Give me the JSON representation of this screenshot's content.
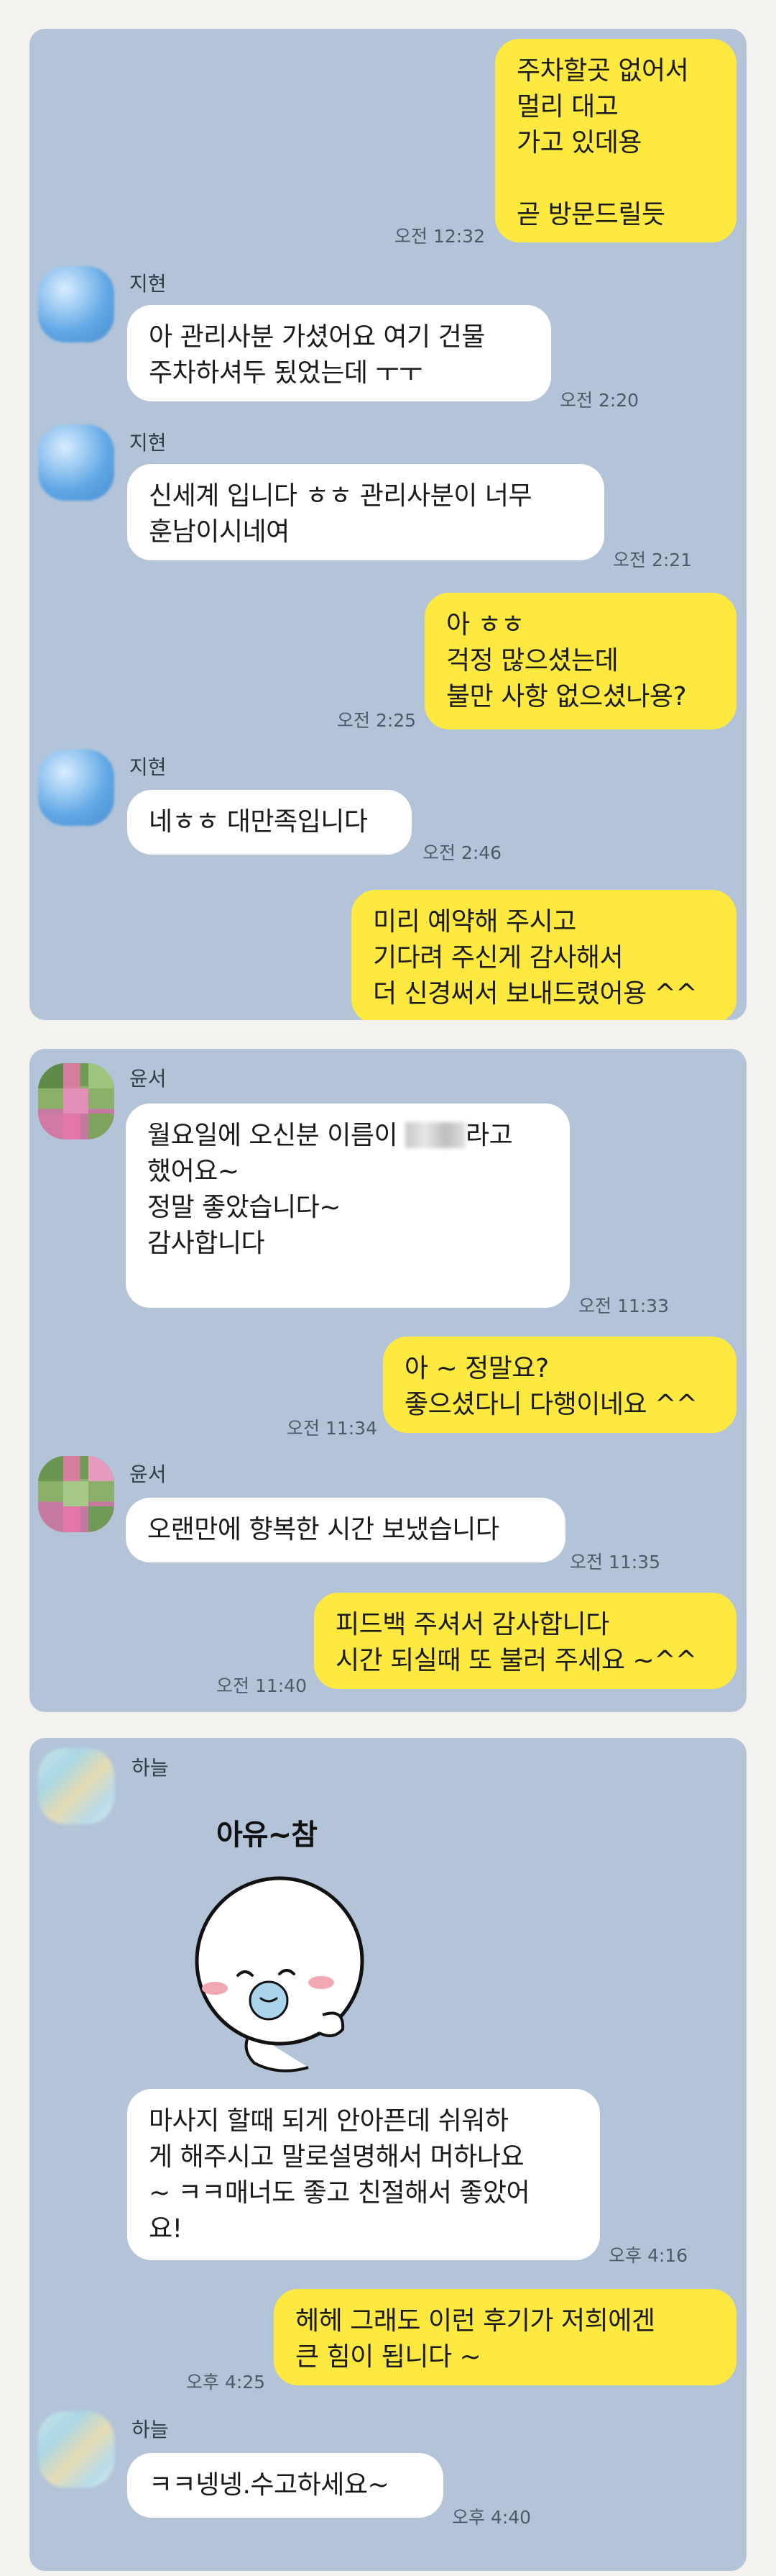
{
  "panel1": {
    "m1": {
      "text": "주차할곳 없어서\n멀리 대고\n가고 있데용\n\n곧 방문드릴듯",
      "time": "오전 12:32"
    },
    "m2": {
      "sender": "지현",
      "text": "아 관리사분 가셨어요 여기 건물\n주차하셔두 됬었는데 ㅜㅜ",
      "time": "오전 2:20"
    },
    "m3": {
      "sender": "지현",
      "text": "신세계 입니다 ㅎㅎ 관리사분이 너무\n훈남이시네여",
      "time": "오전 2:21"
    },
    "m4": {
      "text": "아 ㅎㅎ\n걱정 많으셨는데\n불만 사항 없으셨나용?",
      "time": "오전 2:25"
    },
    "m5": {
      "sender": "지현",
      "text": "네ㅎㅎ 대만족입니다",
      "time": "오전 2:46"
    },
    "m6": {
      "text": "미리 예약해 주시고\n기다려 주신게 감사해서\n더 신경써서 보내드렸어용 ^^"
    }
  },
  "panel2": {
    "m1": {
      "sender": "윤서",
      "line1a": "월요일에 오신분 이름이 ",
      "line1b": "라고",
      "rest": "했어요~\n정말 좋았습니다~\n감사합니다",
      "time": "오전 11:33"
    },
    "m2": {
      "text": "아 ~ 정말요?\n좋으셨다니 다행이네요 ^^",
      "time": "오전 11:34"
    },
    "m3": {
      "sender": "윤서",
      "text": "오랜만에 향복한 시간 보냈습니다",
      "time": "오전 11:35"
    },
    "m4": {
      "text": "피드백 주셔서 감사합니다\n시간 되실때 또 불러 주세요 ~^^",
      "time": "오전 11:40"
    }
  },
  "panel3": {
    "sender": "하늘",
    "sticker_text": "아유~참",
    "m1": {
      "text": "마사지 할때 되게 안아픈데 쉬워하\n게 해주시고 말로설명해서 머하나요\n~ ㅋㅋ매너도 좋고 친절해서 좋았어\n요!",
      "time": "오후 4:16"
    },
    "m2": {
      "text": "헤헤 그래도 이런 후기가 저희에겐\n큰 힘이 됩니다 ~",
      "time": "오후 4:25"
    },
    "m3": {
      "sender": "하늘",
      "text": "ㅋㅋ넹넹.수고하세요~",
      "time": "오후 4:40"
    }
  },
  "colors": {
    "chat_background": "#b3c4d9",
    "outgoing_bubble": "#fde93f",
    "incoming_bubble": "#ffffff",
    "page_background": "#f4f2ee"
  },
  "icons": [
    "avatar-blurred-blue",
    "avatar-pixelated-green",
    "avatar-blurred-sky",
    "sticker-shy-character"
  ]
}
